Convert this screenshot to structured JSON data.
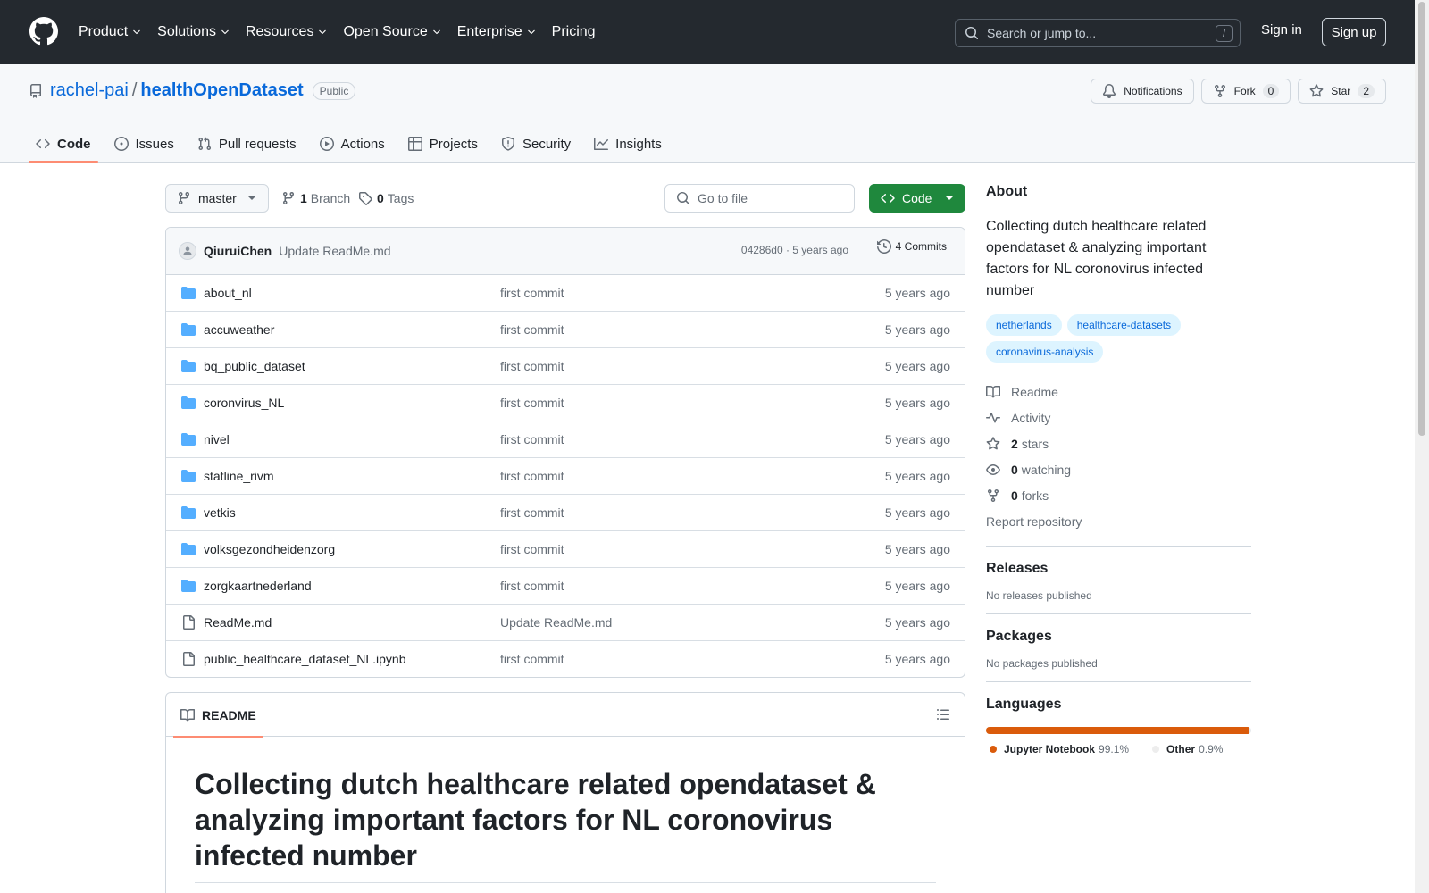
{
  "header": {
    "nav": [
      {
        "label": "Product",
        "dropdown": true
      },
      {
        "label": "Solutions",
        "dropdown": true
      },
      {
        "label": "Resources",
        "dropdown": true
      },
      {
        "label": "Open Source",
        "dropdown": true
      },
      {
        "label": "Enterprise",
        "dropdown": true
      },
      {
        "label": "Pricing",
        "dropdown": false
      }
    ],
    "search_placeholder": "Search or jump to...",
    "search_shortcut": "/",
    "signin": "Sign in",
    "signup": "Sign up"
  },
  "repo": {
    "owner": "rachel-pai",
    "slash": "/",
    "name": "healthOpenDataset",
    "visibility": "Public",
    "notifications_label": "Notifications",
    "fork_label": "Fork",
    "fork_count": "0",
    "star_label": "Star",
    "star_count": "2"
  },
  "tabs": [
    {
      "label": "Code",
      "icon": "code-icon",
      "active": true
    },
    {
      "label": "Issues",
      "icon": "issue-icon",
      "active": false
    },
    {
      "label": "Pull requests",
      "icon": "pull-request-icon",
      "active": false
    },
    {
      "label": "Actions",
      "icon": "play-icon",
      "active": false
    },
    {
      "label": "Projects",
      "icon": "table-icon",
      "active": false
    },
    {
      "label": "Security",
      "icon": "shield-icon",
      "active": false
    },
    {
      "label": "Insights",
      "icon": "graph-icon",
      "active": false
    }
  ],
  "branch": {
    "name": "master",
    "branch_count": "1",
    "branch_label": "Branch",
    "tag_count": "0",
    "tag_label": "Tags",
    "goto_placeholder": "Go to file",
    "code_button": "Code"
  },
  "commit": {
    "author": "QiuruiChen",
    "message": "Update ReadMe.md",
    "meta": "04286d0 · 5 years ago",
    "count_label": "4 Commits"
  },
  "files": [
    {
      "name": "about_nl",
      "type": "dir",
      "message": "first commit",
      "time": "5 years ago"
    },
    {
      "name": "accuweather",
      "type": "dir",
      "message": "first commit",
      "time": "5 years ago"
    },
    {
      "name": "bq_public_dataset",
      "type": "dir",
      "message": "first commit",
      "time": "5 years ago"
    },
    {
      "name": "coronvirus_NL",
      "type": "dir",
      "message": "first commit",
      "time": "5 years ago"
    },
    {
      "name": "nivel",
      "type": "dir",
      "message": "first commit",
      "time": "5 years ago"
    },
    {
      "name": "statline_rivm",
      "type": "dir",
      "message": "first commit",
      "time": "5 years ago"
    },
    {
      "name": "vetkis",
      "type": "dir",
      "message": "first commit",
      "time": "5 years ago"
    },
    {
      "name": "volksgezondheidenzorg",
      "type": "dir",
      "message": "first commit",
      "time": "5 years ago"
    },
    {
      "name": "zorgkaartnederland",
      "type": "dir",
      "message": "first commit",
      "time": "5 years ago"
    },
    {
      "name": "ReadMe.md",
      "type": "file",
      "message": "Update ReadMe.md",
      "time": "5 years ago"
    },
    {
      "name": "public_healthcare_dataset_NL.ipynb",
      "type": "file",
      "message": "first commit",
      "time": "5 years ago"
    }
  ],
  "readme": {
    "tab_label": "README",
    "title": "Collecting dutch healthcare related opendataset & analyzing important factors for NL coronovirus infected number"
  },
  "about": {
    "heading": "About",
    "description": "Collecting dutch healthcare related opendataset & analyzing important factors for NL coronovirus infected number",
    "topics": [
      "netherlands",
      "healthcare-datasets",
      "coronavirus-analysis"
    ],
    "readme_label": "Readme",
    "activity_label": "Activity",
    "stars_count": "2",
    "stars_label": "stars",
    "watching_count": "0",
    "watching_label": "watching",
    "forks_count": "0",
    "forks_label": "forks",
    "report_label": "Report repository"
  },
  "releases": {
    "heading": "Releases",
    "note": "No releases published"
  },
  "packages": {
    "heading": "Packages",
    "note": "No packages published"
  },
  "languages": {
    "heading": "Languages",
    "items": [
      {
        "name": "Jupyter Notebook",
        "percent": "99.1%",
        "fraction": 0.991,
        "color": "#da5b0b"
      },
      {
        "name": "Other",
        "percent": "0.9%",
        "fraction": 0.009,
        "color": "#ededed"
      }
    ]
  }
}
